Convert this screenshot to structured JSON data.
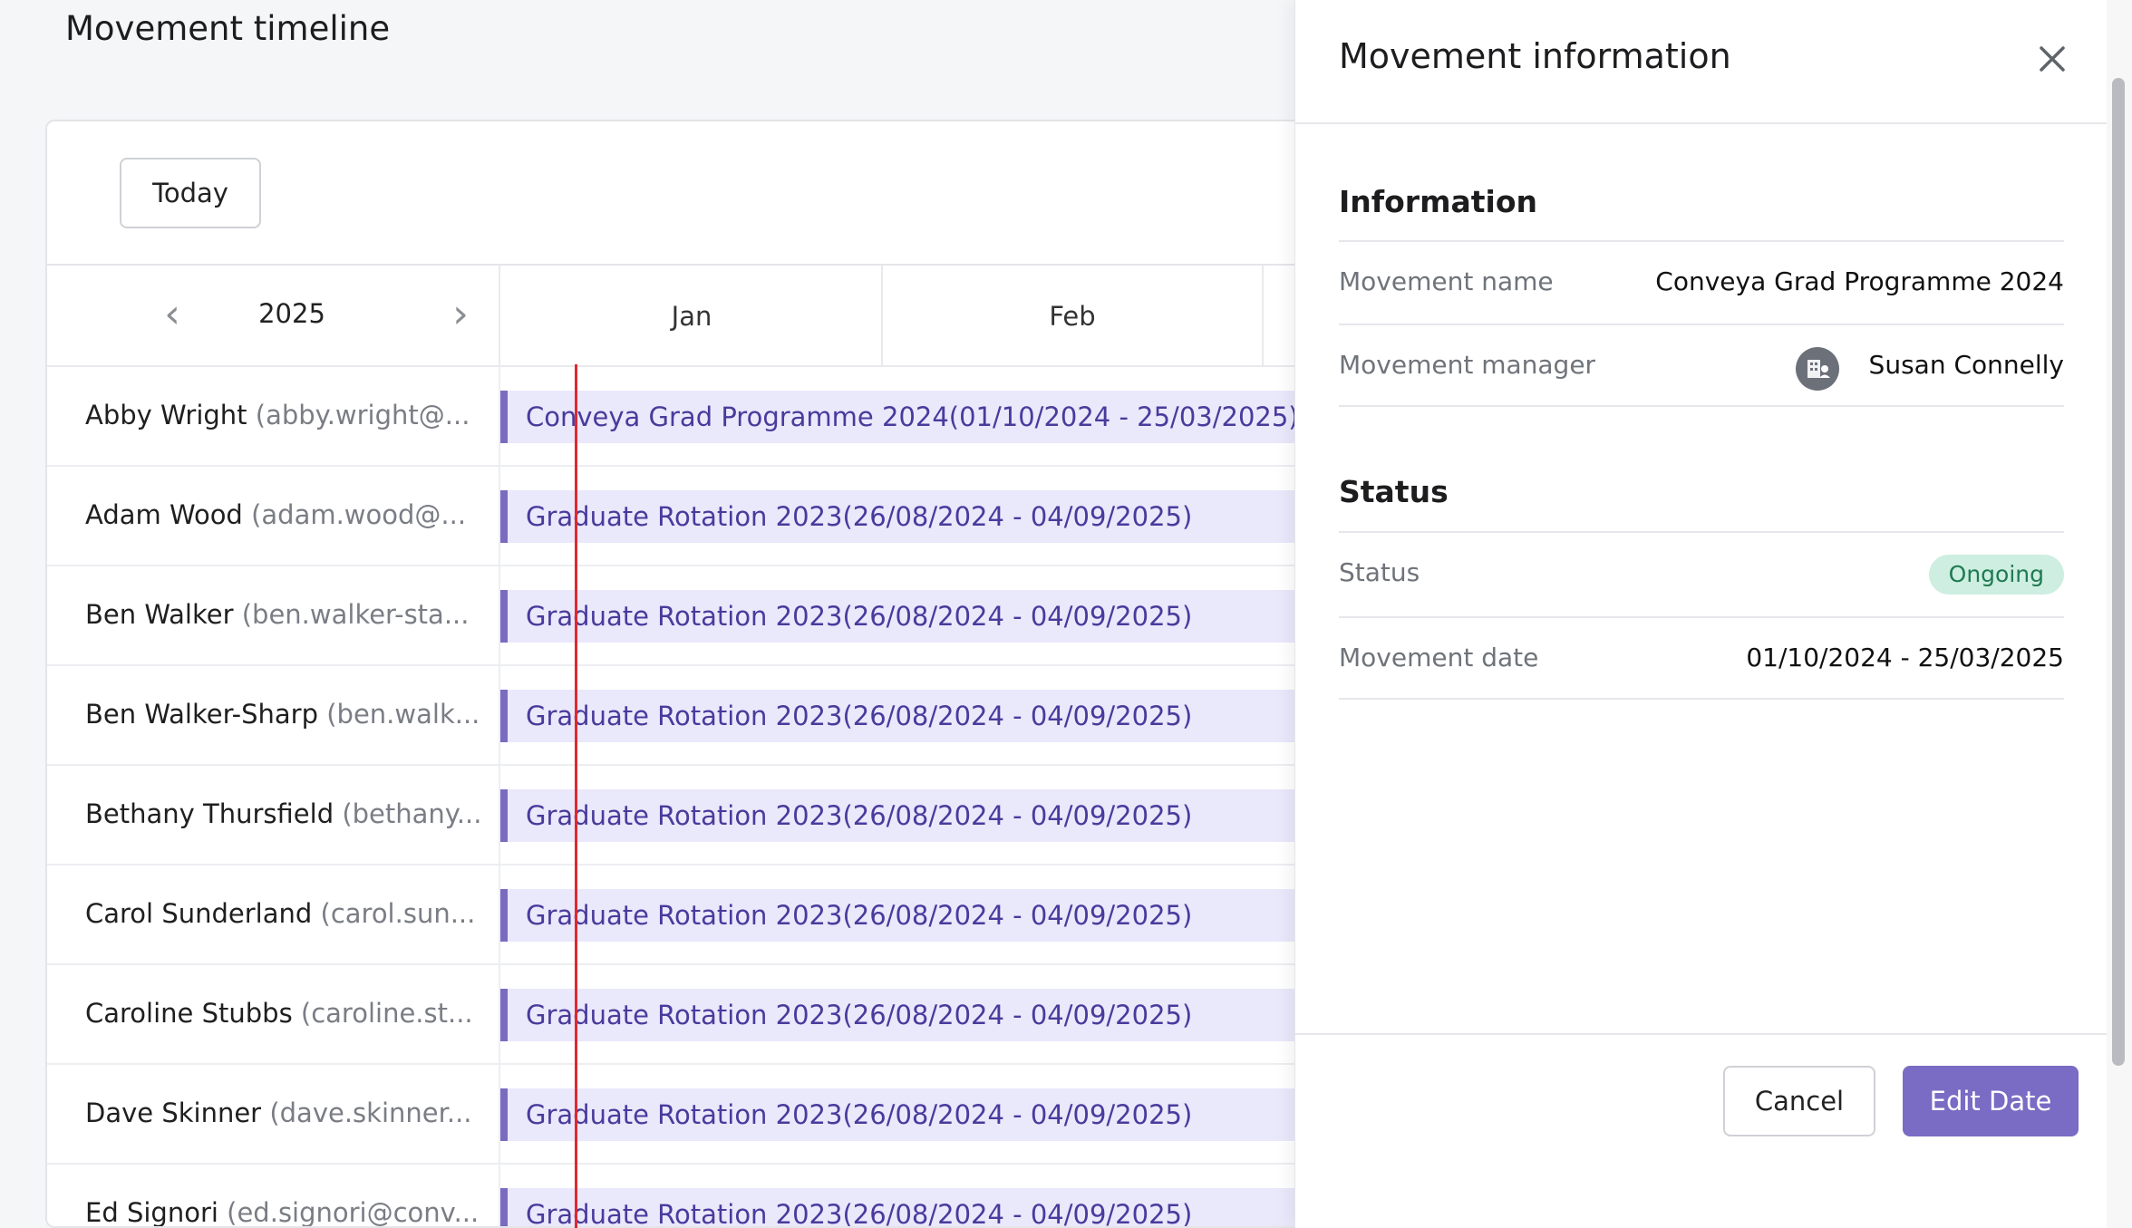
{
  "page": {
    "title": "Movement timeline"
  },
  "toolbar": {
    "today_label": "Today"
  },
  "calendar": {
    "year": "2025",
    "months": [
      "Jan",
      "Feb"
    ]
  },
  "rows": [
    {
      "name": "Abby Wright",
      "email": "(abby.wright@...",
      "movement": "Conveya Grad Programme 2024(01/10/2024 - 25/03/2025)"
    },
    {
      "name": "Adam Wood",
      "email": "(adam.wood@...",
      "movement": "Graduate Rotation 2023(26/08/2024 - 04/09/2025)"
    },
    {
      "name": "Ben Walker",
      "email": "(ben.walker-sta...",
      "movement": "Graduate Rotation 2023(26/08/2024 - 04/09/2025)"
    },
    {
      "name": "Ben Walker-Sharp",
      "email": "(ben.walk...",
      "movement": "Graduate Rotation 2023(26/08/2024 - 04/09/2025)"
    },
    {
      "name": "Bethany Thursfield",
      "email": "(bethany...",
      "movement": "Graduate Rotation 2023(26/08/2024 - 04/09/2025)"
    },
    {
      "name": "Carol Sunderland",
      "email": "(carol.sun...",
      "movement": "Graduate Rotation 2023(26/08/2024 - 04/09/2025)"
    },
    {
      "name": "Caroline Stubbs",
      "email": "(caroline.st...",
      "movement": "Graduate Rotation 2023(26/08/2024 - 04/09/2025)"
    },
    {
      "name": "Dave Skinner",
      "email": "(dave.skinner...",
      "movement": "Graduate Rotation 2023(26/08/2024 - 04/09/2025)"
    },
    {
      "name": "Ed Signori",
      "email": "(ed.signori@conv...",
      "movement": "Graduate Rotation 2023(26/08/2024 - 04/09/2025)"
    }
  ],
  "drawer": {
    "title": "Movement information",
    "information": {
      "heading": "Information",
      "movement_name_label": "Movement name",
      "movement_name_value": "Conveya Grad Programme 2024",
      "movement_manager_label": "Movement manager",
      "movement_manager_value": "Susan Connelly"
    },
    "status": {
      "heading": "Status",
      "status_label": "Status",
      "status_value": "Ongoing",
      "movement_date_label": "Movement date",
      "movement_date_value": "01/10/2024 - 25/03/2025"
    },
    "footer": {
      "cancel_label": "Cancel",
      "edit_label": "Edit Date"
    }
  },
  "colors": {
    "accent": "#7a6bc4",
    "bar_fill": "#eae8fb",
    "bar_text": "#4a3a9c",
    "today_line": "#e0282f",
    "status_bg": "#cdeee0",
    "status_text": "#207a52"
  },
  "icons": [
    "chevron-left-icon",
    "chevron-right-icon",
    "close-icon",
    "manager-avatar-icon"
  ]
}
